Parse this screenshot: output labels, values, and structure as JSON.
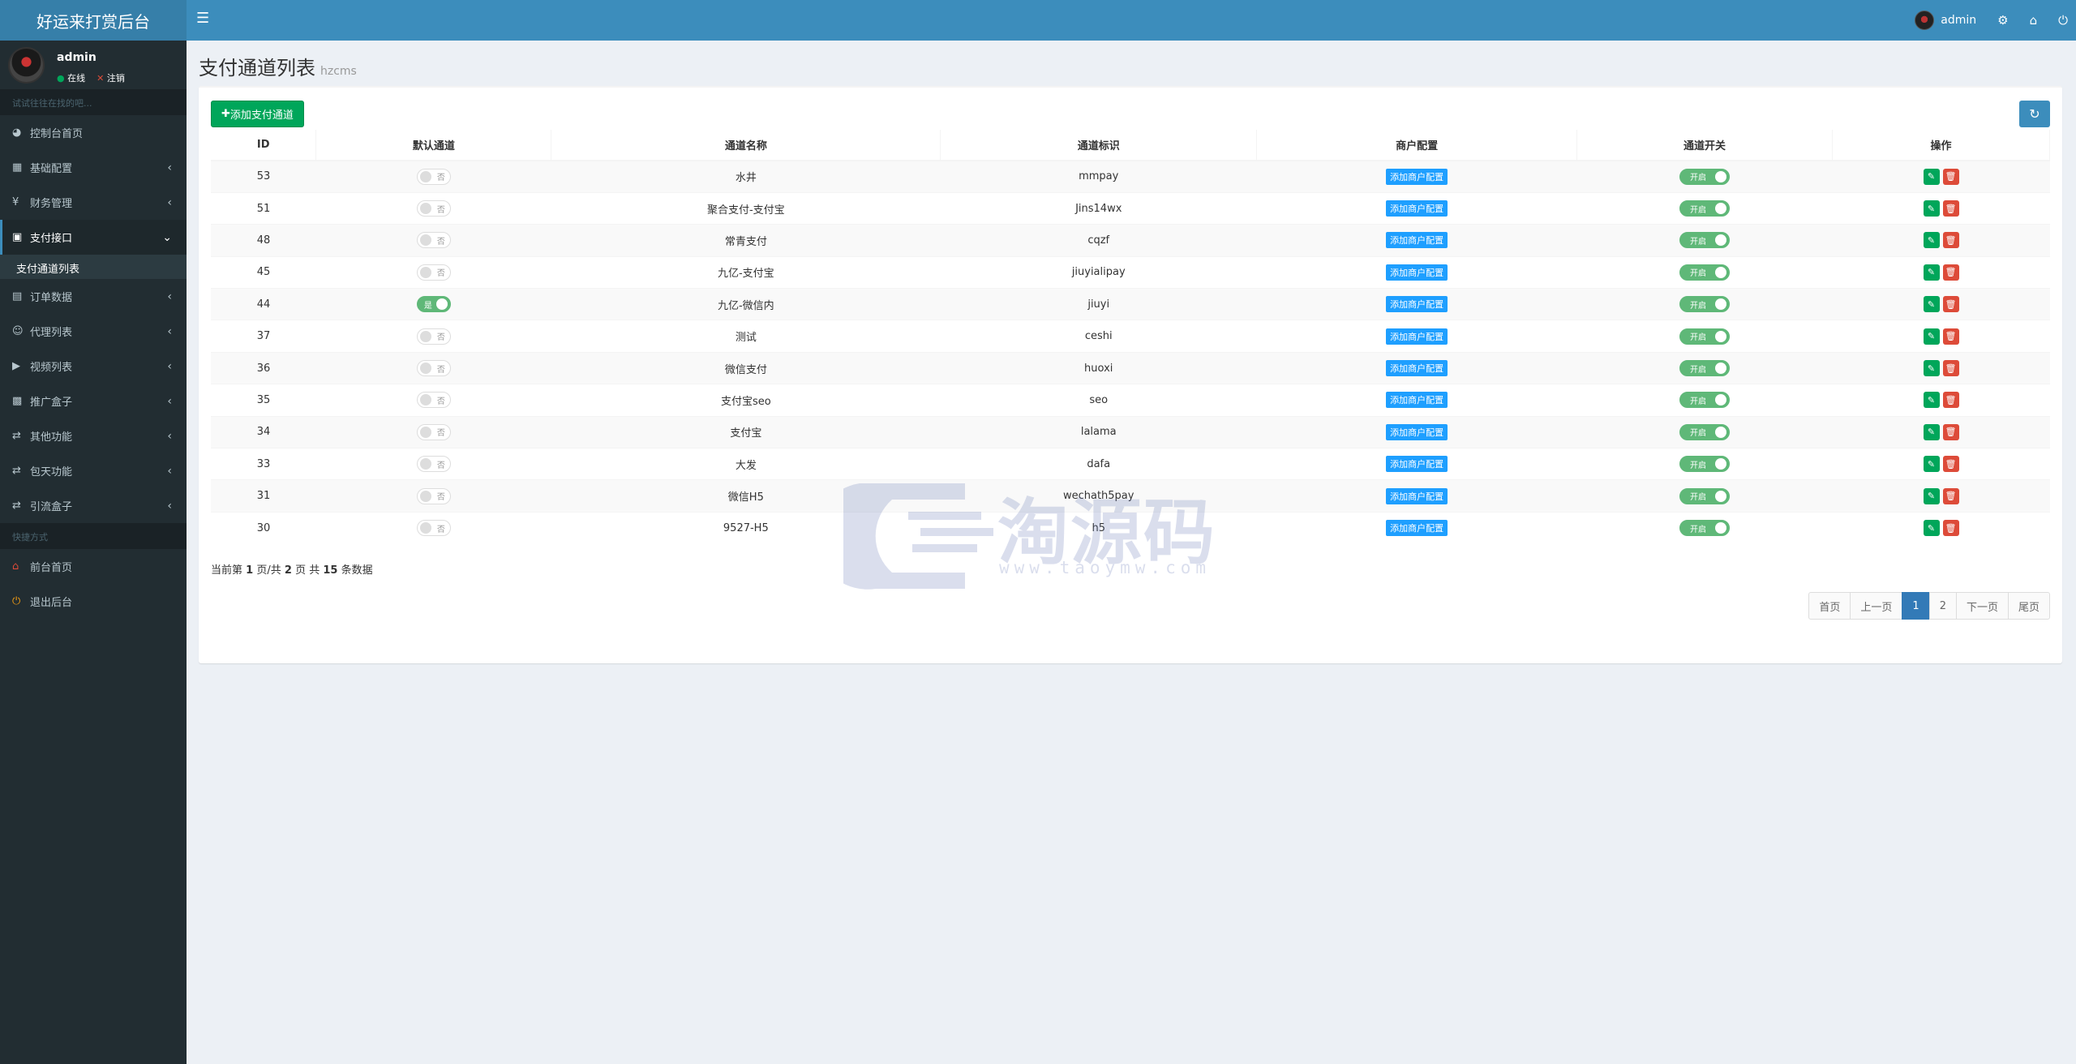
{
  "app": {
    "title": "好运来打赏后台"
  },
  "topbar": {
    "user_name": "admin"
  },
  "sidebar": {
    "user": {
      "name": "admin",
      "online": "在线",
      "logout": "注销"
    },
    "search_hint": "试试往往在找的吧...",
    "items": [
      {
        "label": "控制台首页",
        "icon": "dashboard-icon"
      },
      {
        "label": "基础配置",
        "icon": "grid-icon"
      },
      {
        "label": "财务管理",
        "icon": "yen-icon"
      },
      {
        "label": "支付接口",
        "icon": "payment-icon",
        "active": true,
        "sub": "支付通道列表"
      },
      {
        "label": "订单数据",
        "icon": "bar-chart-icon"
      },
      {
        "label": "代理列表",
        "icon": "users-icon"
      },
      {
        "label": "视频列表",
        "icon": "video-icon"
      },
      {
        "label": "推广盒子",
        "icon": "table-icon"
      },
      {
        "label": "其他功能",
        "icon": "retweet-icon"
      },
      {
        "label": "包天功能",
        "icon": "retweet-icon"
      },
      {
        "label": "引流盒子",
        "icon": "retweet-icon"
      }
    ],
    "quick_header": "快捷方式",
    "quick": [
      {
        "label": "前台首页",
        "icon": "home-icon"
      },
      {
        "label": "退出后台",
        "icon": "power-icon"
      }
    ]
  },
  "page": {
    "title": "支付通道列表",
    "subtitle": "hzcms"
  },
  "toolbar": {
    "add_label": "添加支付通道"
  },
  "table": {
    "headers": [
      "ID",
      "默认通道",
      "通道名称",
      "通道标识",
      "商户配置",
      "通道开关",
      "操作"
    ],
    "merchant_btn": "添加商户配置",
    "rows": [
      {
        "id": "53",
        "default": false,
        "name": "水井",
        "code": "mmpay",
        "enabled": true
      },
      {
        "id": "51",
        "default": false,
        "name": "聚合支付-支付宝",
        "code": "Jins14wx",
        "enabled": true
      },
      {
        "id": "48",
        "default": false,
        "name": "常青支付",
        "code": "cqzf",
        "enabled": true
      },
      {
        "id": "45",
        "default": false,
        "name": "九亿-支付宝",
        "code": "jiuyialipay",
        "enabled": true
      },
      {
        "id": "44",
        "default": true,
        "name": "九亿-微信内",
        "code": "jiuyi",
        "enabled": true
      },
      {
        "id": "37",
        "default": false,
        "name": "测试",
        "code": "ceshi",
        "enabled": true
      },
      {
        "id": "36",
        "default": false,
        "name": "微信支付",
        "code": "huoxi",
        "enabled": true
      },
      {
        "id": "35",
        "default": false,
        "name": "支付宝seo",
        "code": "seo",
        "enabled": true
      },
      {
        "id": "34",
        "default": false,
        "name": "支付宝",
        "code": "lalama",
        "enabled": true
      },
      {
        "id": "33",
        "default": false,
        "name": "大发",
        "code": "dafa",
        "enabled": true
      },
      {
        "id": "31",
        "default": false,
        "name": "微信H5",
        "code": "wechath5pay",
        "enabled": true
      },
      {
        "id": "30",
        "default": false,
        "name": "9527-H5",
        "code": "h5",
        "enabled": true
      }
    ],
    "switch_on": "是",
    "switch_off": "否",
    "enable_on": "开启"
  },
  "summary": {
    "prefix": "当前第",
    "page": "1",
    "mid1": "页/共",
    "pages": "2",
    "mid2": "页 共",
    "total": "15",
    "suffix": "条数据"
  },
  "pagination": {
    "first": "首页",
    "prev": "上一页",
    "p1": "1",
    "p2": "2",
    "next": "下一页",
    "last": "尾页"
  },
  "watermark": {
    "text": "淘源码",
    "url": "www.taoymw.com"
  }
}
